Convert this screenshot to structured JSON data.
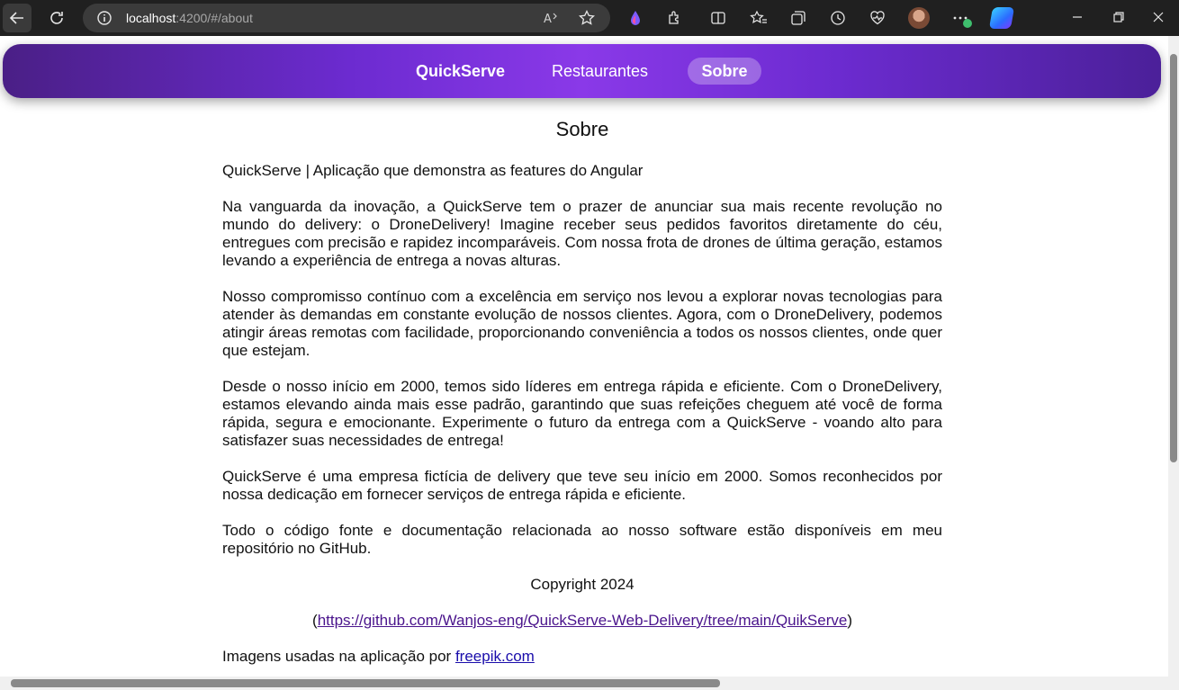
{
  "browser": {
    "url_host": "localhost",
    "url_rest": ":4200/#/about"
  },
  "nav": {
    "brand": "QuickServe",
    "restaurants": "Restaurantes",
    "about": "Sobre"
  },
  "page": {
    "title": "Sobre",
    "subtitle": "QuickServe | Aplicação que demonstra as features do Angular",
    "paragraphs": [
      "Na vanguarda da inovação, a QuickServe tem o prazer de anunciar sua mais recente revolução no mundo do delivery: o DroneDelivery! Imagine receber seus pedidos favoritos diretamente do céu, entregues com precisão e rapidez incomparáveis. Com nossa frota de drones de última geração, estamos levando a experiência de entrega a novas alturas.",
      "Nosso compromisso contínuo com a excelência em serviço nos levou a explorar novas tecnologias para atender às demandas em constante evolução de nossos clientes. Agora, com o DroneDelivery, podemos atingir áreas remotas com facilidade, proporcionando conveniência a todos os nossos clientes, onde quer que estejam.",
      "Desde o nosso início em 2000, temos sido líderes em entrega rápida e eficiente. Com o DroneDelivery, estamos elevando ainda mais esse padrão, garantindo que suas refeições cheguem até você de forma rápida, segura e emocionante. Experimente o futuro da entrega com a QuickServe - voando alto para satisfazer suas necessidades de entrega!",
      "QuickServe é uma empresa fictícia de delivery que teve seu início em 2000. Somos reconhecidos por nossa dedicação em fornecer serviços de entrega rápida e eficiente.",
      "Todo o código fonte e documentação relacionada ao nosso software estão disponíveis em meu repositório no GitHub."
    ],
    "copyright": "Copyright 2024",
    "repo_open": "(",
    "repo_link": "https://github.com/Wanjos-eng/QuickServe-Web-Delivery/tree/main/QuikServe",
    "repo_close": ")",
    "images_text": "Imagens usadas na aplicação por ",
    "images_link": "freepik.com"
  },
  "colors": {
    "nav_gradient_mid": "#8a39e8",
    "nav_gradient_edge": "#4a1f86",
    "link": "#4a148c"
  }
}
